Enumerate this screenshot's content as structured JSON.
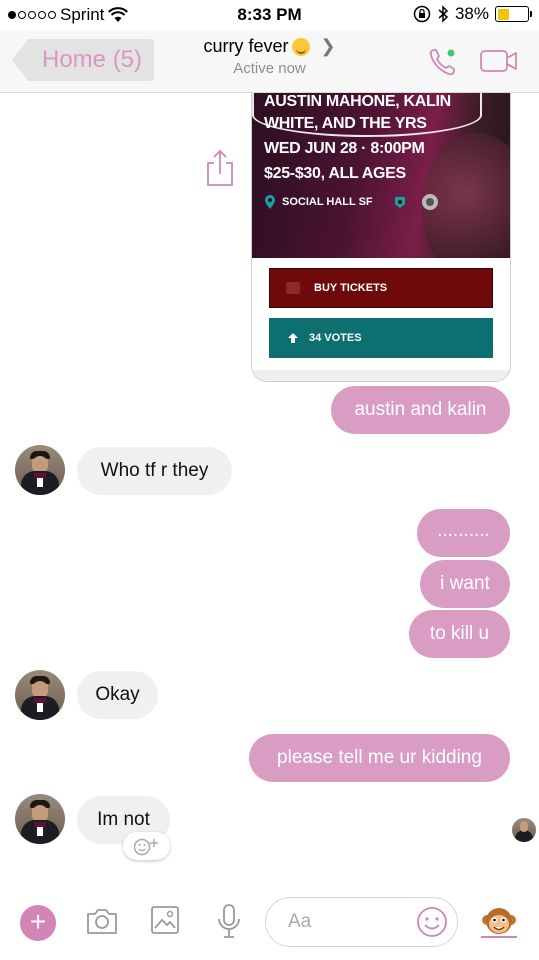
{
  "status_bar": {
    "carrier": "Sprint",
    "time": "8:33 PM",
    "battery": "38%",
    "battery_level": 0.38,
    "signal_bars_filled": 1,
    "signal_bars_total": 5
  },
  "header": {
    "back_label": "Home (5)",
    "title": "curry fever",
    "subtitle": "Active now",
    "accent_color": "#d386b6"
  },
  "event_card": {
    "line1": "AUSTIN MAHONE, KALIN",
    "line2": "WHITE, AND THE YRS",
    "line3": "WED JUN 28 · 8:00PM",
    "line4": "$25-$30, ALL AGES",
    "venue": "SOCIAL HALL SF",
    "buy_label": "BUY TICKETS",
    "votes_label": "34 VOTES"
  },
  "messages": [
    {
      "from": "me",
      "text": "austin and kalin"
    },
    {
      "from": "them",
      "text": "Who tf r they"
    },
    {
      "from": "me",
      "text": ".........."
    },
    {
      "from": "me",
      "text": "i want"
    },
    {
      "from": "me",
      "text": "to kill u"
    },
    {
      "from": "them",
      "text": "Okay"
    },
    {
      "from": "me",
      "text": "please tell me ur kidding"
    },
    {
      "from": "them",
      "text": "Im not"
    }
  ],
  "composer": {
    "placeholder": "Aa",
    "icons": [
      "plus-icon",
      "camera-icon",
      "image-icon",
      "microphone-icon",
      "emoji-icon",
      "sticker-icon"
    ]
  },
  "colors": {
    "outgoing_bubble": "#d99dc3",
    "incoming_bubble": "#f1f0f0",
    "buy_button": "#6e0a0a",
    "vote_button": "#0e6f71"
  }
}
